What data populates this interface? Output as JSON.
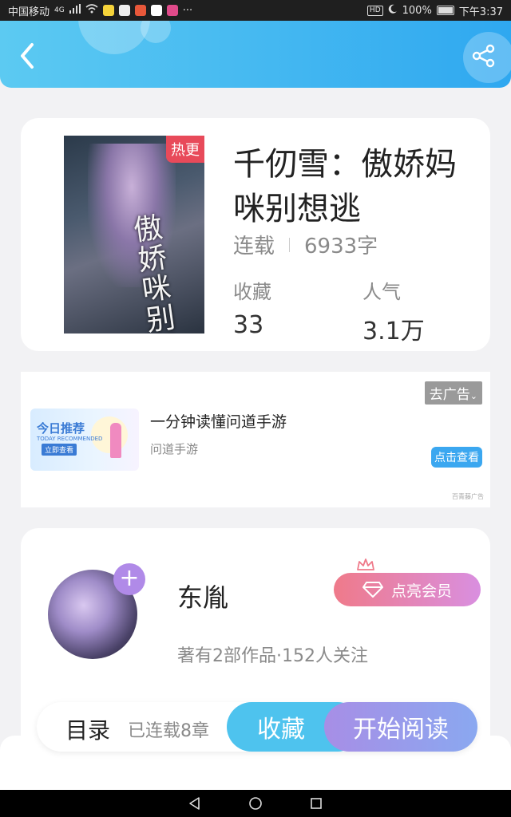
{
  "status_bar": {
    "carrier": "中国移动",
    "network": "4G",
    "more": "···",
    "hd": "HD",
    "battery": "100%",
    "time": "下午3:37"
  },
  "book": {
    "hot_badge": "热更",
    "cover_title": "傲娇咪别想",
    "title": "千仞雪：傲娇妈咪别想逃",
    "status": "连载",
    "word_count": "6933字",
    "collect_label": "收藏",
    "collect_value": "33",
    "popularity_label": "人气",
    "popularity_value": "3.1万"
  },
  "ad": {
    "close_label": "去广告",
    "image_title": "今日推荐",
    "image_subtitle": "TODAY RECOMMENDED",
    "image_button": "立即查看",
    "title": "一分钟读懂问道手游",
    "subtitle": "问道手游",
    "cta": "点击查看",
    "source": "百青藤广告"
  },
  "author": {
    "name": "东胤",
    "vip_label": "点亮会员",
    "meta": "著有2部作品·152人关注"
  },
  "action_bar": {
    "toc": "目录",
    "serial": "已连载8章",
    "collect": "收藏",
    "read": "开始阅读"
  },
  "colors": {
    "header_start": "#5ccaf2",
    "header_end": "#2fa8f0",
    "collect_button": "#4ec3ee",
    "read_button": "#a78ee6",
    "hot_badge": "#e84a5a"
  }
}
